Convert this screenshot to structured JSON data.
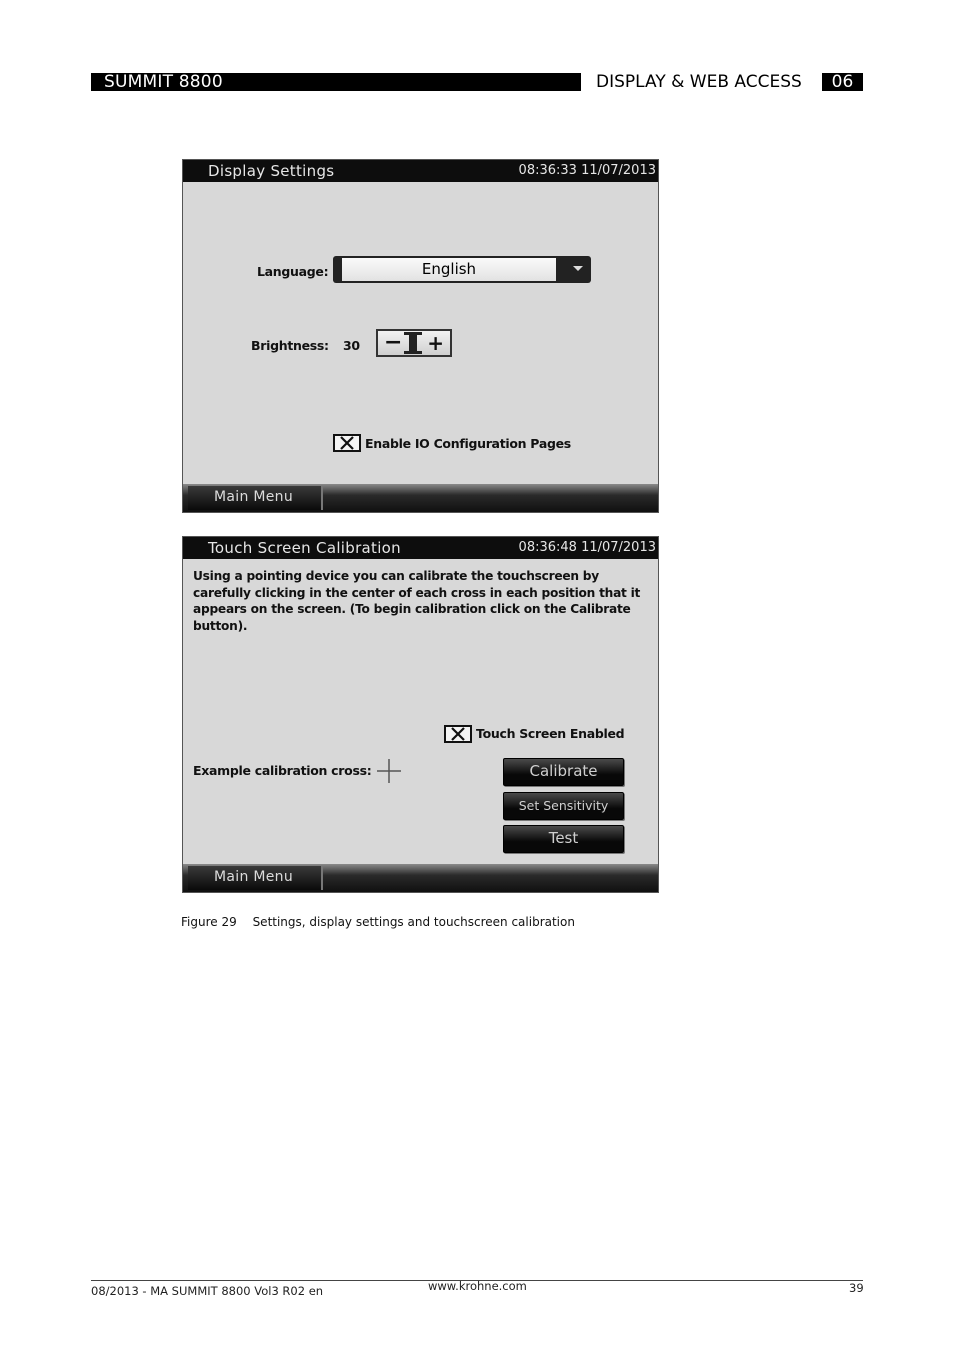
{
  "header": {
    "product": "SUMMIT 8800",
    "section": "DISPLAY & WEB ACCESS",
    "chapter": "06"
  },
  "display_settings": {
    "title": "Display Settings",
    "timestamp": "08:36:33 11/07/2013",
    "language_label": "Language:",
    "language_value": "English",
    "brightness_label": "Brightness:",
    "brightness_value": "30",
    "io_checkbox_label": "Enable IO Configuration Pages",
    "io_checkbox_checked": true,
    "footer_button": "Main Menu"
  },
  "calibration": {
    "title": "Touch Screen Calibration",
    "timestamp": "08:36:48 11/07/2013",
    "instructions": "Using a pointing device you can calibrate the touchscreen by carefully clicking in the center of each cross in each position that it appears on the screen. (To begin calibration click on the Calibrate button).",
    "touch_enabled_label": "Touch Screen Enabled",
    "touch_enabled_checked": true,
    "example_cross_label": "Example calibration cross:",
    "buttons": {
      "calibrate": "Calibrate",
      "sensitivity": "Set Sensitivity",
      "test": "Test"
    },
    "footer_button": "Main Menu"
  },
  "caption": {
    "figure": "Figure 29",
    "text": "Settings, display settings and touchscreen calibration"
  },
  "footer": {
    "doc": "08/2013 - MA SUMMIT 8800 Vol3 R02 en",
    "url": "www.krohne.com",
    "page": "39"
  }
}
